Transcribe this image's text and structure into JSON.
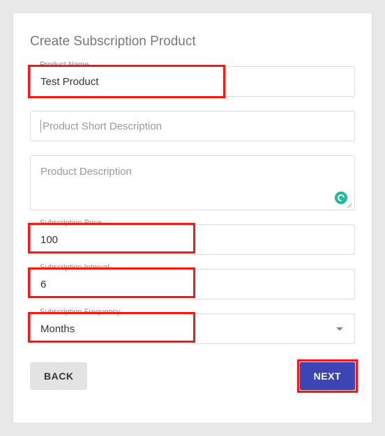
{
  "title": "Create Subscription Product",
  "fields": {
    "product_name": {
      "label": "Product Name",
      "value": "Test Product"
    },
    "short_desc": {
      "placeholder": "Product Short Description",
      "value": ""
    },
    "description": {
      "placeholder": "Product Description",
      "value": ""
    },
    "price": {
      "label": "Subscription Price",
      "value": "100"
    },
    "interval": {
      "label": "Subscription Interval",
      "value": "6"
    },
    "frequency": {
      "label": "Subscription Frequency",
      "value": "Months"
    }
  },
  "buttons": {
    "back": "BACK",
    "next": "NEXT"
  }
}
